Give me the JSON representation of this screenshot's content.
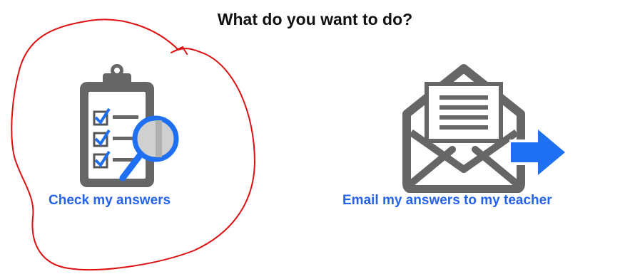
{
  "page": {
    "title": "What do you want to do?"
  },
  "options": [
    {
      "label": "Check my answers",
      "icon": "clipboard-checklist-magnifier-icon"
    },
    {
      "label": "Email my answers to my teacher",
      "icon": "envelope-letter-arrow-icon"
    }
  ],
  "colors": {
    "icon_gray": "#666666",
    "accent_blue": "#1f6ff2",
    "label_blue": "#2563eb",
    "annotation_red": "#dd1111"
  }
}
